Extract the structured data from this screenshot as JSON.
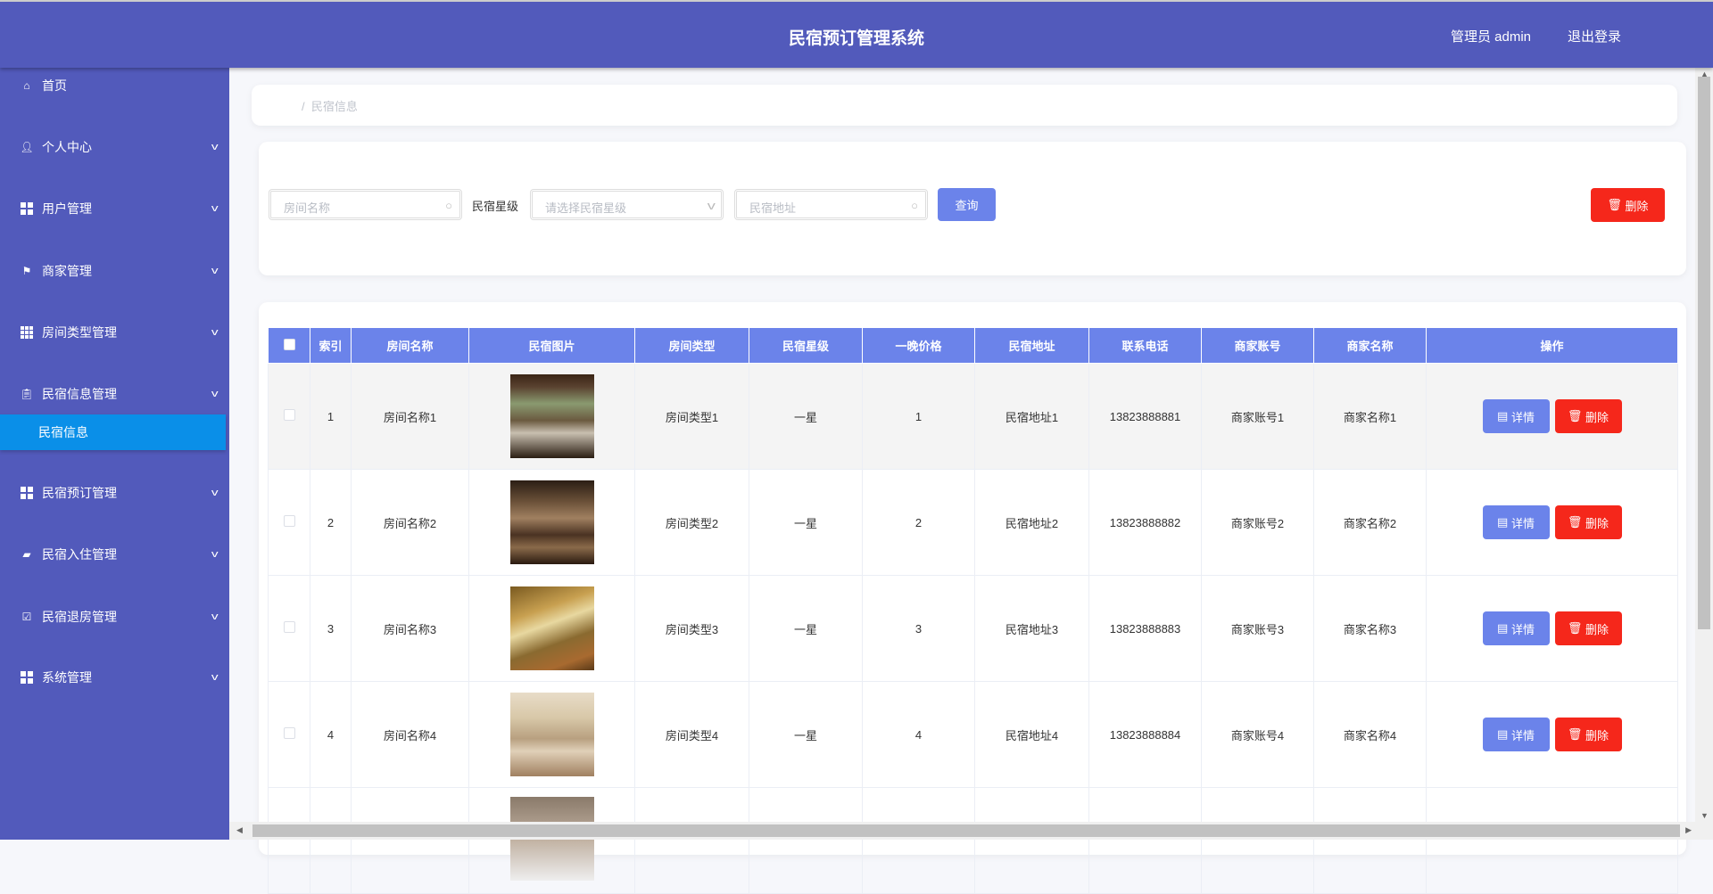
{
  "header": {
    "title": "民宿预订管理系统",
    "user": "管理员 admin",
    "logout": "退出登录"
  },
  "sidebar": {
    "items": [
      {
        "label": "首页",
        "icon": "home-icon"
      },
      {
        "label": "个人中心",
        "icon": "user-icon"
      },
      {
        "label": "用户管理",
        "icon": "grid-icon"
      },
      {
        "label": "商家管理",
        "icon": "flag-icon"
      },
      {
        "label": "房间类型管理",
        "icon": "grid9-icon"
      },
      {
        "label": "民宿信息管理",
        "icon": "clipboard-icon"
      },
      {
        "label": "民宿预订管理",
        "icon": "grid-icon"
      },
      {
        "label": "民宿入住管理",
        "icon": "wallet-icon"
      },
      {
        "label": "民宿退房管理",
        "icon": "clipboard-check-icon"
      },
      {
        "label": "系统管理",
        "icon": "grid-icon"
      }
    ],
    "active_sub": "民宿信息"
  },
  "breadcrumb": {
    "sep": "/",
    "current": "民宿信息"
  },
  "search": {
    "room_name_placeholder": "房间名称",
    "star_label": "民宿星级",
    "star_placeholder": "请选择民宿星级",
    "address_placeholder": "民宿地址",
    "query": "查询",
    "delete": "删除"
  },
  "table": {
    "headers": [
      "索引",
      "房间名称",
      "民宿图片",
      "房间类型",
      "民宿星级",
      "一晚价格",
      "民宿地址",
      "联系电话",
      "商家账号",
      "商家名称",
      "操作"
    ],
    "detail": "详情",
    "delete": "删除",
    "rows": [
      {
        "index": "1",
        "name": "房间名称1",
        "type": "房间类型1",
        "star": "一星",
        "price": "1",
        "address": "民宿地址1",
        "phone": "13823888881",
        "account": "商家账号1",
        "merchant": "商家名称1"
      },
      {
        "index": "2",
        "name": "房间名称2",
        "type": "房间类型2",
        "star": "一星",
        "price": "2",
        "address": "民宿地址2",
        "phone": "13823888882",
        "account": "商家账号2",
        "merchant": "商家名称2"
      },
      {
        "index": "3",
        "name": "房间名称3",
        "type": "房间类型3",
        "star": "一星",
        "price": "3",
        "address": "民宿地址3",
        "phone": "13823888883",
        "account": "商家账号3",
        "merchant": "商家名称3"
      },
      {
        "index": "4",
        "name": "房间名称4",
        "type": "房间类型4",
        "star": "一星",
        "price": "4",
        "address": "民宿地址4",
        "phone": "13823888884",
        "account": "商家账号4",
        "merchant": "商家名称4"
      }
    ]
  },
  "colors": {
    "header": "#525abb",
    "active": "#0a8fe8",
    "primary": "#6b83ea",
    "danger": "#f5271b"
  }
}
